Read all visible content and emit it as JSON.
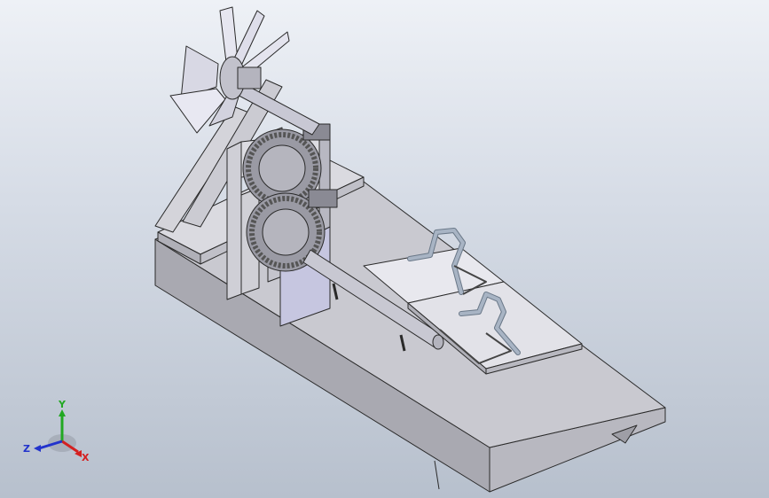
{
  "viewport": {
    "background_top": "#eef1f6",
    "background_bottom": "#b7c0cd"
  },
  "model": {
    "body_color": "#c9c9d0",
    "edge_color": "#2a2a2a",
    "panel_color": "#e8e8ee",
    "gear_color": "#9a9aa4",
    "pipe_color": "#a8b4c4"
  },
  "triad": {
    "x_label": "X",
    "y_label": "Y",
    "z_label": "Z",
    "x_color": "#d42020",
    "y_color": "#22a822",
    "z_color": "#2233cc"
  }
}
